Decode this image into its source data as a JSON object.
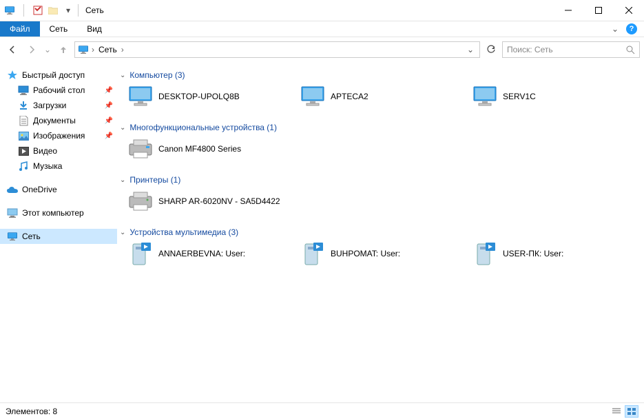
{
  "title": "Сеть",
  "ribbon": {
    "file": "Файл",
    "tabs": [
      "Сеть",
      "Вид"
    ]
  },
  "breadcrumb": {
    "root": "Сеть"
  },
  "search": {
    "placeholder": "Поиск: Сеть"
  },
  "sidebar": {
    "quick_access": {
      "label": "Быстрый доступ",
      "items": [
        {
          "label": "Рабочий стол",
          "pinned": true,
          "icon": "desktop"
        },
        {
          "label": "Загрузки",
          "pinned": true,
          "icon": "downloads"
        },
        {
          "label": "Документы",
          "pinned": true,
          "icon": "documents"
        },
        {
          "label": "Изображения",
          "pinned": true,
          "icon": "pictures"
        },
        {
          "label": "Видео",
          "pinned": false,
          "icon": "videos"
        },
        {
          "label": "Музыка",
          "pinned": false,
          "icon": "music"
        }
      ]
    },
    "onedrive": {
      "label": "OneDrive"
    },
    "this_pc": {
      "label": "Этот компьютер"
    },
    "network": {
      "label": "Сеть"
    }
  },
  "groups": [
    {
      "title": "Компьютер",
      "count": 3,
      "type": "computer",
      "items": [
        "DESKTOP-UPOLQ8B",
        "APTECA2",
        "SERV1C"
      ]
    },
    {
      "title": "Многофункциональные устройства",
      "count": 1,
      "type": "mfp",
      "items": [
        "Canon MF4800 Series"
      ]
    },
    {
      "title": "Принтеры",
      "count": 1,
      "type": "printer",
      "items": [
        "SHARP AR-6020NV - SA5D4422"
      ]
    },
    {
      "title": "Устройства мультимедиа",
      "count": 3,
      "type": "media",
      "items": [
        "ANNAERBEVNA: User:",
        "BUHPOMAT: User:",
        "USER-ПК: User:"
      ]
    }
  ],
  "status": {
    "text": "Элементов: 8"
  }
}
